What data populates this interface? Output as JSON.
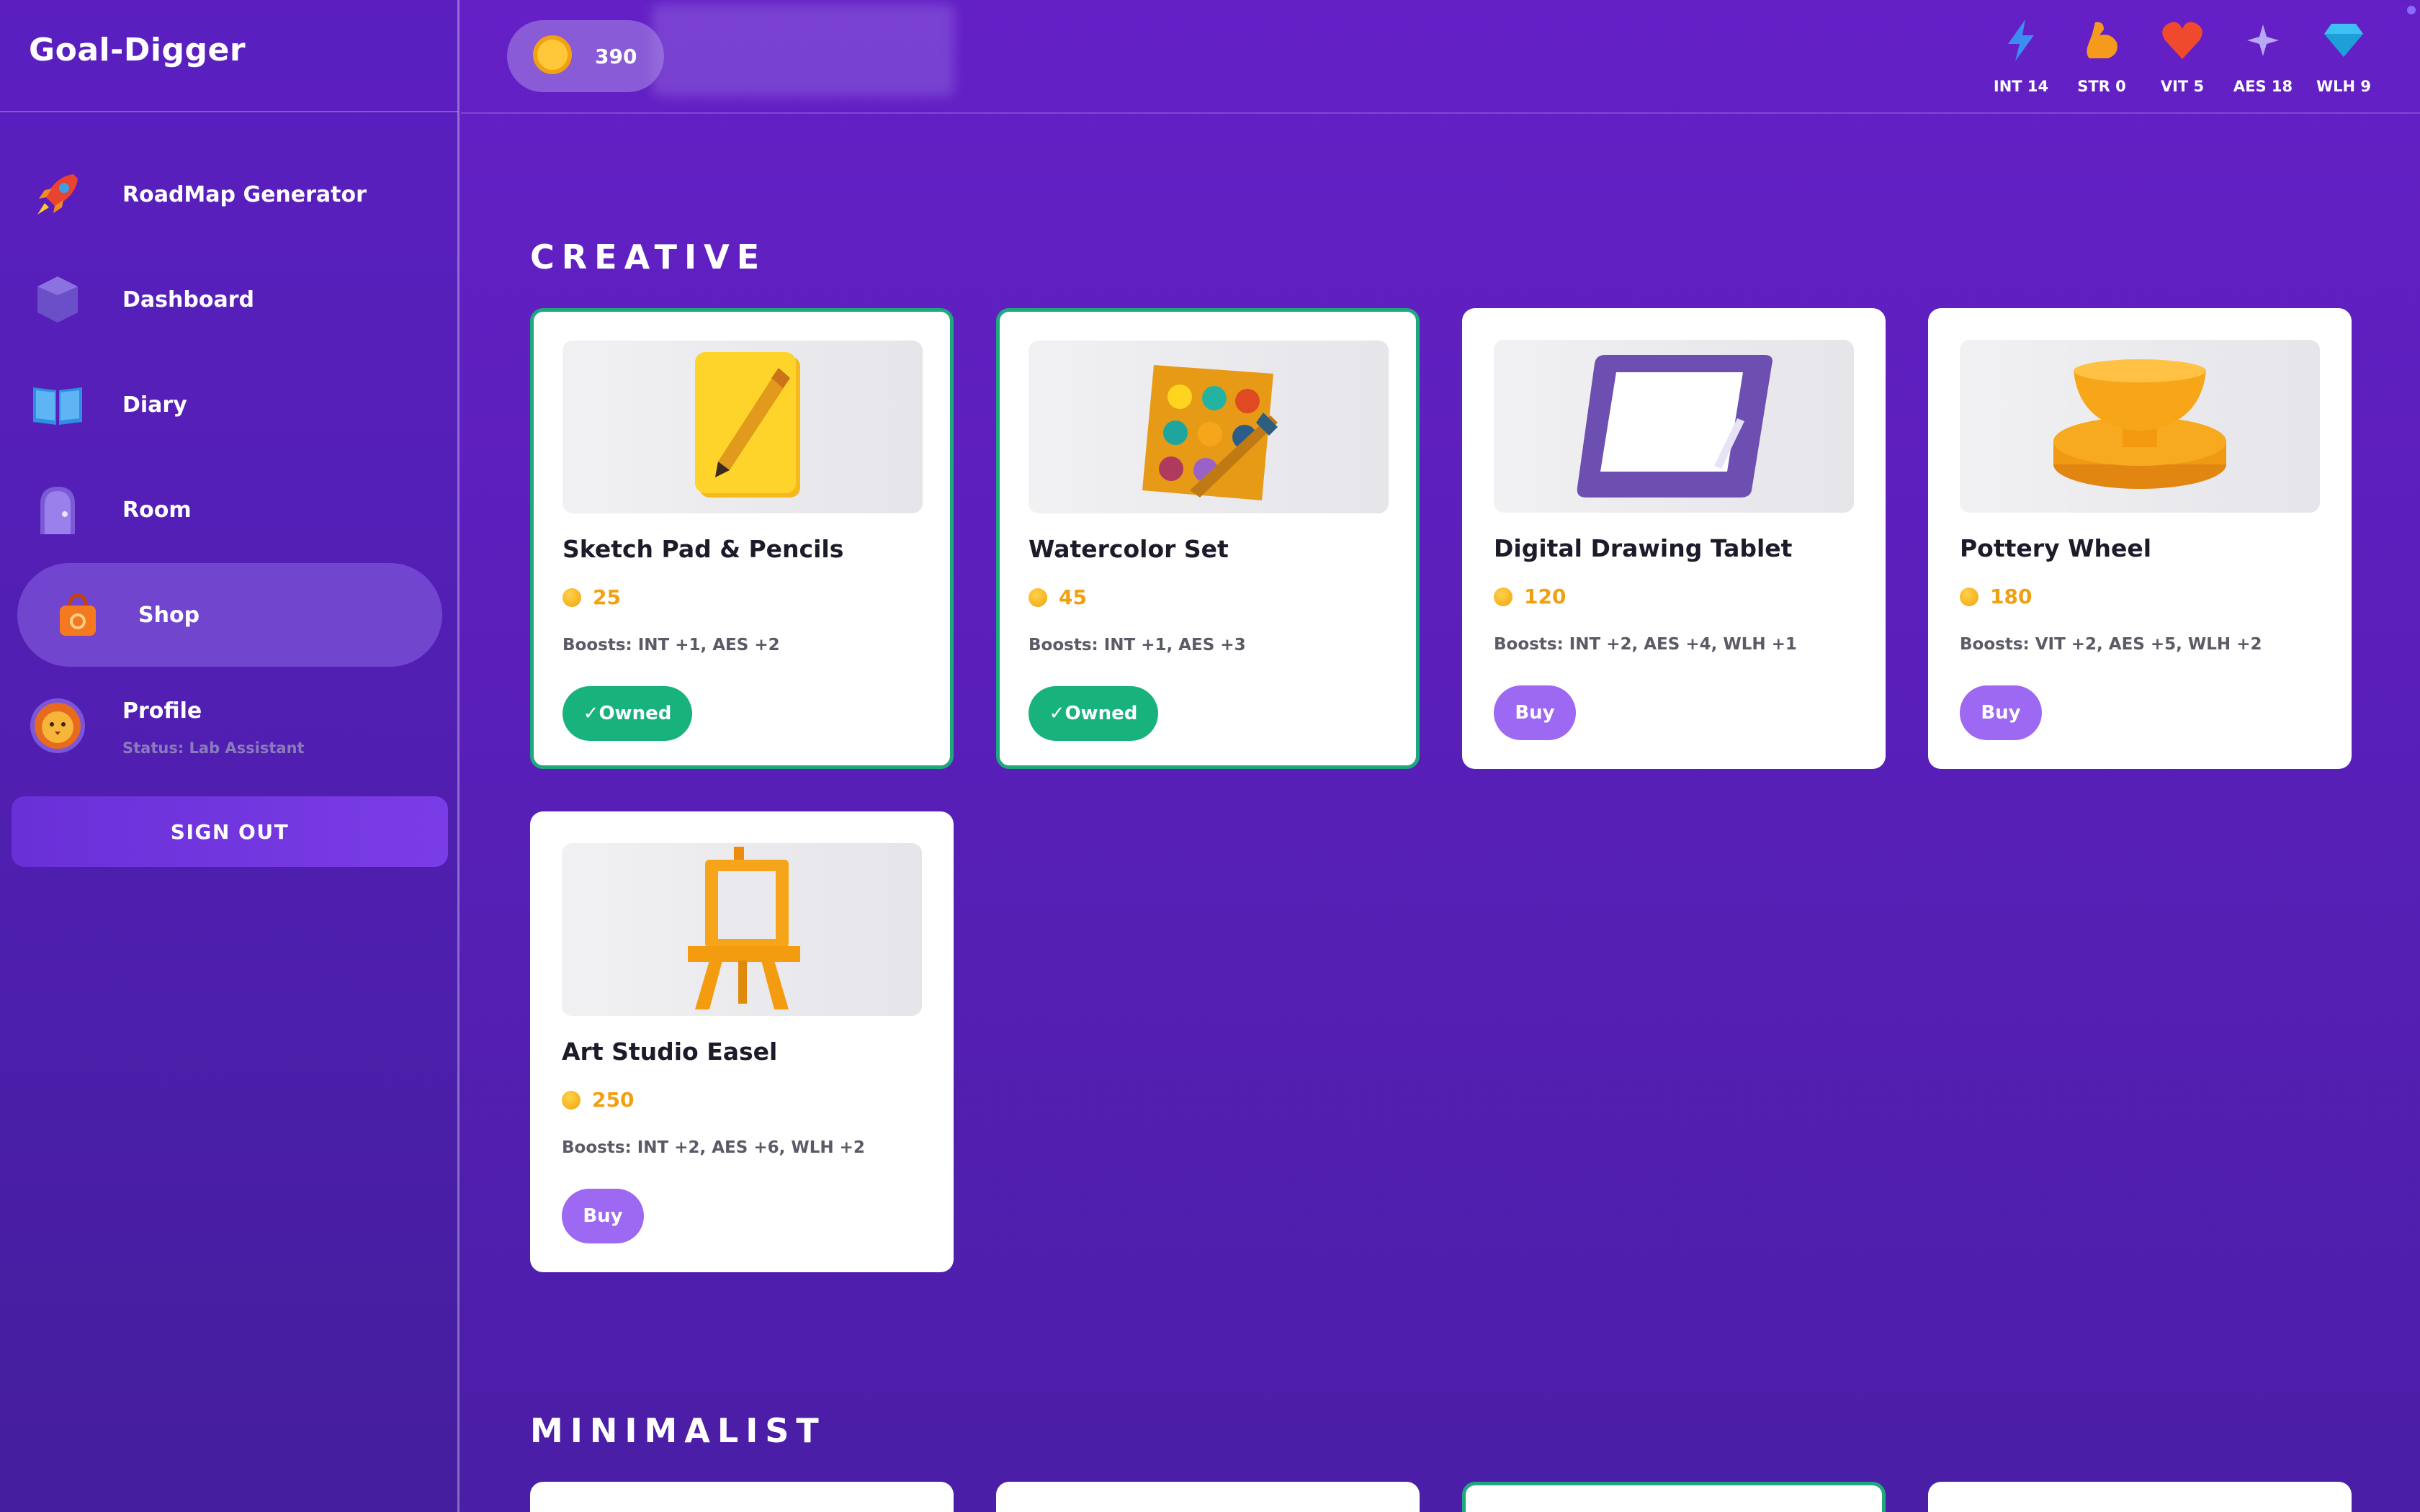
{
  "app": {
    "title": "Goal-Digger"
  },
  "sidebar": {
    "items": [
      {
        "label": "RoadMap Generator",
        "icon": "rocket-icon"
      },
      {
        "label": "Dashboard",
        "icon": "gem-icon"
      },
      {
        "label": "Diary",
        "icon": "book-icon"
      },
      {
        "label": "Room",
        "icon": "door-icon"
      },
      {
        "label": "Shop",
        "icon": "shopping-bag-icon",
        "active": true
      },
      {
        "label": "Profile",
        "icon": "lion-avatar-icon",
        "status": "Status: Lab Assistant"
      }
    ],
    "signout_label": "SIGN OUT"
  },
  "topbar": {
    "coins": "390",
    "stats": [
      {
        "label": "INT 14",
        "icon": "lightning-icon"
      },
      {
        "label": "STR 0",
        "icon": "muscle-icon"
      },
      {
        "label": "VIT 5",
        "icon": "heart-icon"
      },
      {
        "label": "AES 18",
        "icon": "sparkle-icon"
      },
      {
        "label": "WLH 9",
        "icon": "diamond-icon"
      }
    ]
  },
  "sections": [
    {
      "title": "CREATIVE",
      "items": [
        {
          "name": "Sketch Pad & Pencils",
          "price": "25",
          "boosts": "Boosts: INT +1, AES +2",
          "status": "owned",
          "action_label": "✓Owned",
          "icon": "sketchpad-icon"
        },
        {
          "name": "Watercolor Set",
          "price": "45",
          "boosts": "Boosts: INT +1, AES +3",
          "status": "owned",
          "action_label": "✓Owned",
          "icon": "palette-icon"
        },
        {
          "name": "Digital Drawing Tablet",
          "price": "120",
          "boosts": "Boosts: INT +2, AES +4, WLH +1",
          "status": "buy",
          "action_label": "Buy",
          "icon": "tablet-icon"
        },
        {
          "name": "Pottery Wheel",
          "price": "180",
          "boosts": "Boosts: VIT +2, AES +5, WLH +2",
          "status": "buy",
          "action_label": "Buy",
          "icon": "pottery-wheel-icon"
        },
        {
          "name": "Art Studio Easel",
          "price": "250",
          "boosts": "Boosts: INT +2, AES +6, WLH +2",
          "status": "buy",
          "action_label": "Buy",
          "icon": "easel-icon"
        }
      ]
    },
    {
      "title": "MINIMALIST"
    }
  ],
  "colors": {
    "background": "#5a1fba",
    "owned_border": "#1ea87c",
    "owned_button": "#18b27d",
    "buy_button": "#9d68f2",
    "price": "#f0a010"
  }
}
